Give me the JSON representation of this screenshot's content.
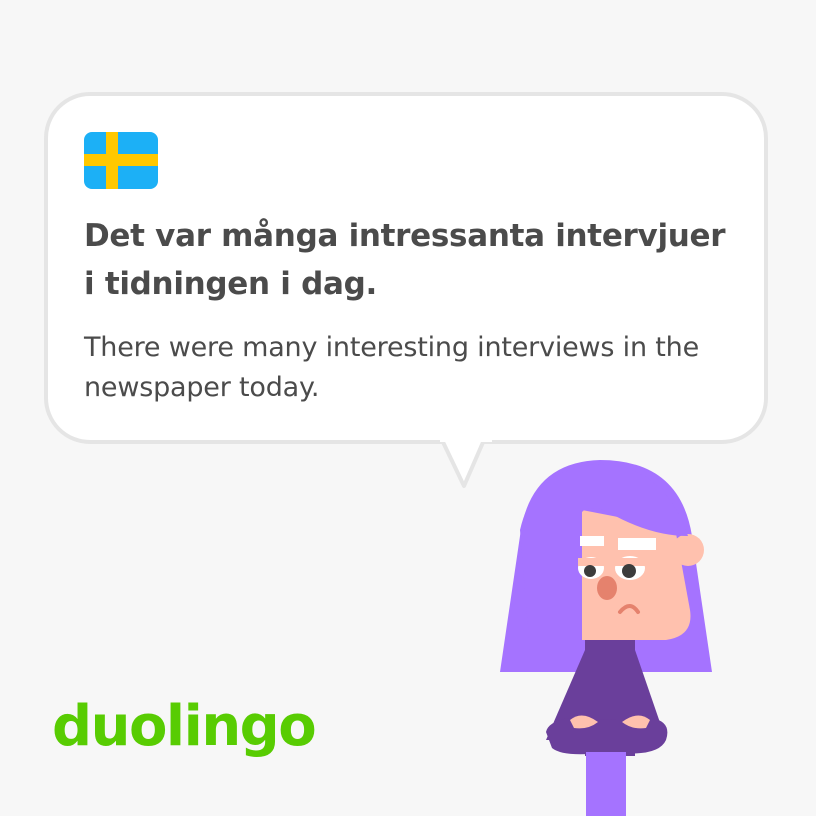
{
  "card": {
    "flag_icon": "sweden-flag-icon",
    "sentence": "Det var många intressanta intervjuer i tidningen i dag.",
    "translation": "There were many interesting interviews in the newspaper today."
  },
  "logo": {
    "text": "duolingo"
  },
  "character": {
    "icon": "lily-character-illustration"
  },
  "colors": {
    "background": "#f7f7f7",
    "card": "#ffffff",
    "card_border": "#e5e5e5",
    "text": "#4b4b4b",
    "brand_green": "#58cc02",
    "flag_blue": "#1cb0f6",
    "flag_yellow": "#ffc800",
    "hair_purple": "#a573ff",
    "shirt_purple": "#6a3f9b",
    "skin": "#ffc1ae"
  }
}
